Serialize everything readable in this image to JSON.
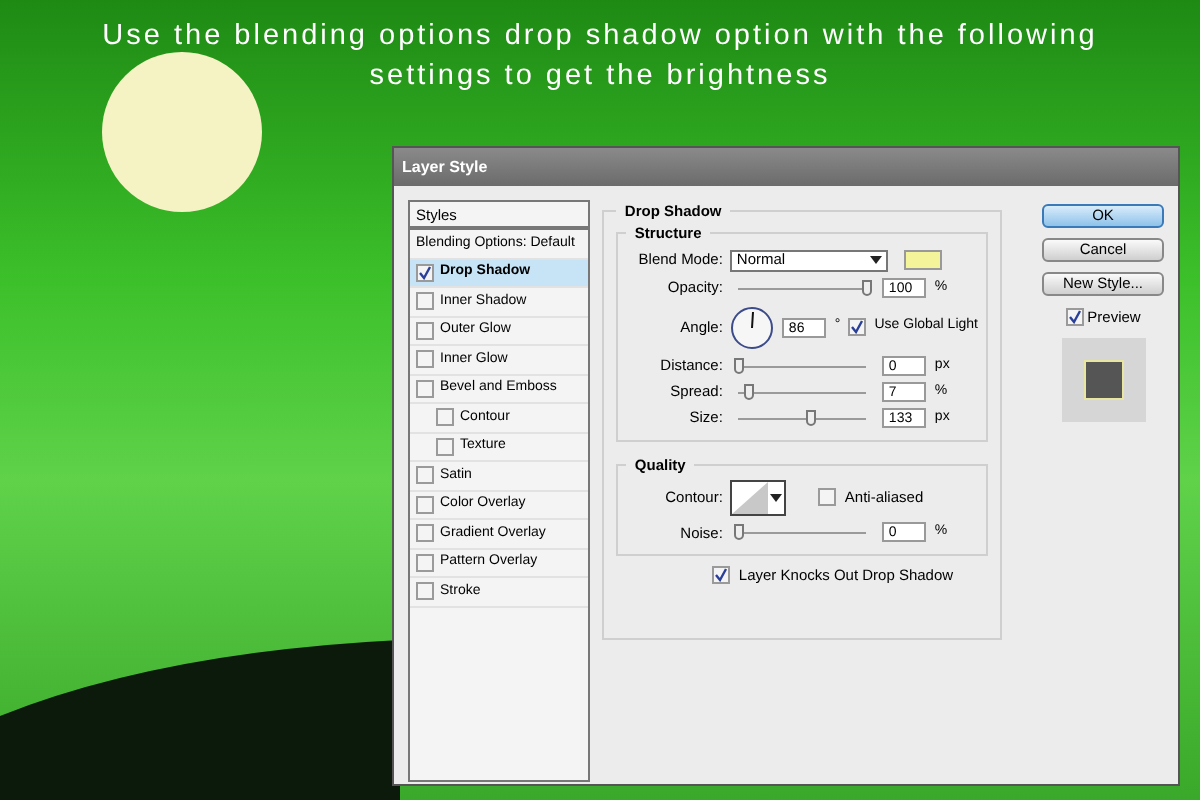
{
  "caption": "Use the blending options drop shadow option with the following settings to get the brightness",
  "dialog": {
    "title": "Layer Style",
    "styles_list": {
      "header": "Styles",
      "items": [
        {
          "label": "Blending Options: Default",
          "kind": "plain",
          "selected": false
        },
        {
          "label": "Drop Shadow",
          "kind": "effect",
          "checked": true,
          "selected": true
        },
        {
          "label": "Inner Shadow",
          "kind": "effect",
          "checked": false,
          "selected": false
        },
        {
          "label": "Outer Glow",
          "kind": "effect",
          "checked": false,
          "selected": false
        },
        {
          "label": "Inner Glow",
          "kind": "effect",
          "checked": false,
          "selected": false
        },
        {
          "label": "Bevel and Emboss",
          "kind": "effect",
          "checked": false,
          "selected": false,
          "children": [
            {
              "label": "Contour",
              "kind": "effect",
              "checked": false,
              "selected": false
            },
            {
              "label": "Texture",
              "kind": "effect",
              "checked": false,
              "selected": false
            }
          ]
        },
        {
          "label": "Satin",
          "kind": "effect",
          "checked": false,
          "selected": false
        },
        {
          "label": "Color Overlay",
          "kind": "effect",
          "checked": false,
          "selected": false
        },
        {
          "label": "Gradient Overlay",
          "kind": "effect",
          "checked": false,
          "selected": false
        },
        {
          "label": "Pattern Overlay",
          "kind": "effect",
          "checked": false,
          "selected": false
        },
        {
          "label": "Stroke",
          "kind": "effect",
          "checked": false,
          "selected": false
        }
      ]
    },
    "section_title": "Drop Shadow",
    "structure": {
      "title": "Structure",
      "rows": [
        {
          "kind": "select",
          "label": "Blend Mode:",
          "value": "Normal",
          "color": "#f4f49a"
        },
        {
          "kind": "slider",
          "label": "Opacity:",
          "level": 1.0,
          "value": "100",
          "unit": "%"
        },
        {
          "kind": "angle",
          "label": "Angle:",
          "value": "86",
          "unit": "°",
          "checkbox": {
            "label": "Use Global Light",
            "checked": true
          }
        },
        {
          "kind": "slider",
          "label": "Distance:",
          "level": 0,
          "value": "0",
          "unit": "px"
        },
        {
          "kind": "slider",
          "label": "Spread:",
          "level": 0.07,
          "value": "7",
          "unit": "%"
        },
        {
          "kind": "slider",
          "label": "Size:",
          "level": 0.55,
          "value": "133",
          "unit": "px"
        }
      ]
    },
    "quality": {
      "title": "Quality",
      "rows": [
        {
          "kind": "contour",
          "label": "Contour:",
          "checkbox": {
            "label": "Anti-aliased",
            "checked": false
          }
        },
        {
          "kind": "slider",
          "label": "Noise:",
          "level": 0,
          "value": "0",
          "unit": "%"
        }
      ]
    },
    "knockout": {
      "label": "Layer Knocks Out Drop Shadow",
      "checked": true
    },
    "buttons": [
      {
        "label": "OK",
        "kind": "default"
      },
      {
        "label": "Cancel",
        "kind": "normal"
      },
      {
        "label": "New Style...",
        "kind": "normal"
      }
    ],
    "preview": {
      "label": "Preview",
      "checked": true
    }
  }
}
